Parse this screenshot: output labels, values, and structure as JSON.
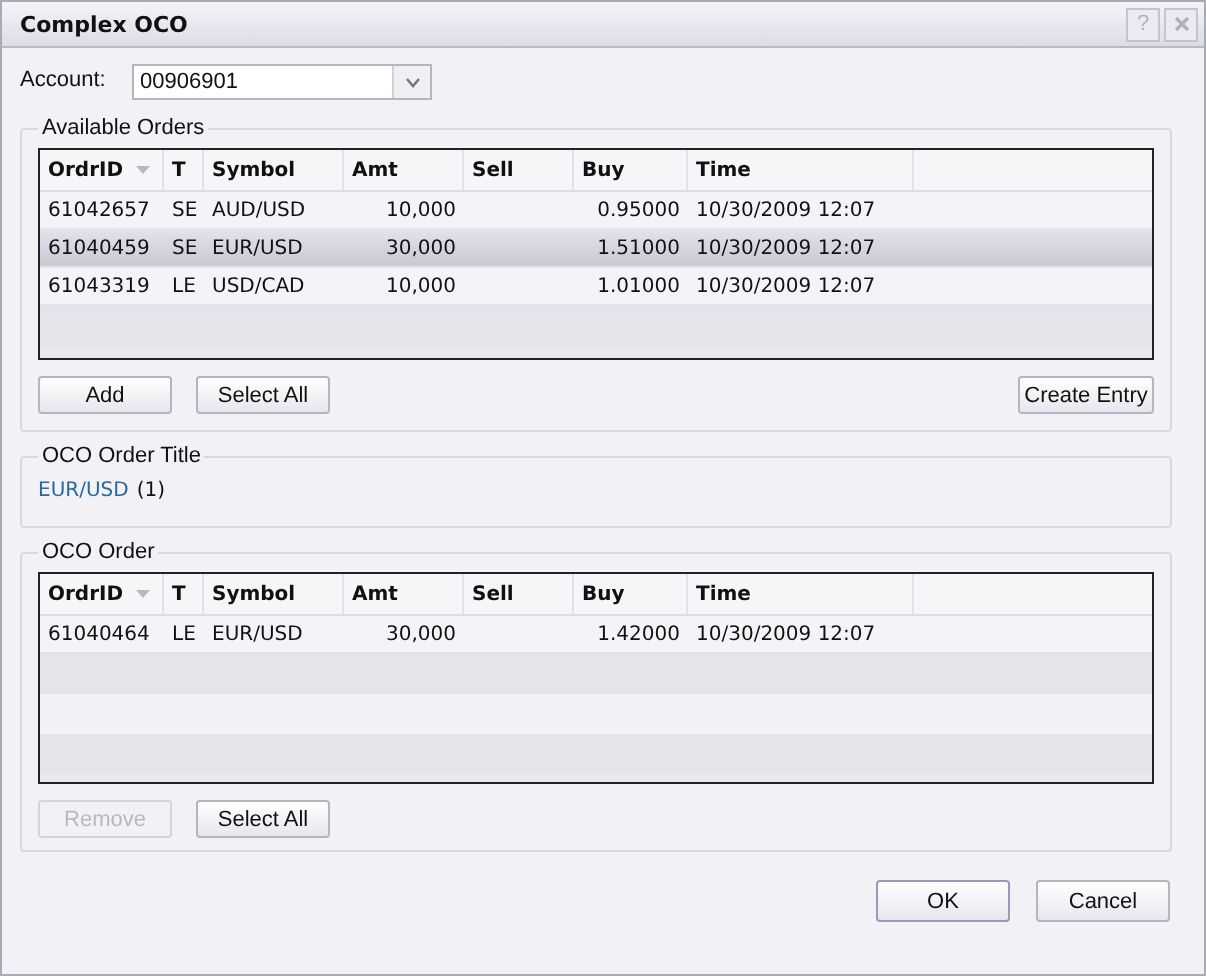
{
  "window": {
    "title": "Complex OCO",
    "help_label": "?"
  },
  "account": {
    "label": "Account:",
    "value": "00906901"
  },
  "available_orders": {
    "title": "Available Orders",
    "columns": [
      "OrdrID",
      "T",
      "Symbol",
      "Amt",
      "Sell",
      "Buy",
      "Time"
    ],
    "rows": [
      {
        "cells": [
          "61042657",
          "SE",
          "AUD/USD",
          "10,000",
          "",
          "0.95000",
          "10/30/2009 12:07"
        ],
        "selected": false
      },
      {
        "cells": [
          "61040459",
          "SE",
          "EUR/USD",
          "30,000",
          "",
          "1.51000",
          "10/30/2009 12:07"
        ],
        "selected": true
      },
      {
        "cells": [
          "61043319",
          "LE",
          "USD/CAD",
          "10,000",
          "",
          "1.01000",
          "10/30/2009 12:07"
        ],
        "selected": false
      }
    ],
    "buttons": [
      {
        "label": "Add",
        "disabled": false
      },
      {
        "label": "Select All",
        "disabled": false
      }
    ],
    "right_button": {
      "label": "Create Entry",
      "disabled": false
    }
  },
  "oco_order_title": {
    "title": "OCO Order Title",
    "symbol": "EUR/USD",
    "count": "(1)"
  },
  "oco_order": {
    "title": "OCO Order",
    "columns": [
      "OrdrID",
      "T",
      "Symbol",
      "Amt",
      "Sell",
      "Buy",
      "Time"
    ],
    "rows": [
      {
        "cells": [
          "61040464",
          "LE",
          "EUR/USD",
          "30,000",
          "",
          "1.42000",
          "10/30/2009 12:07"
        ],
        "selected": false
      }
    ],
    "buttons": [
      {
        "label": "Remove",
        "disabled": true
      },
      {
        "label": "Select All",
        "disabled": false
      }
    ]
  },
  "footer_buttons": [
    {
      "label": "OK",
      "default": true
    },
    {
      "label": "Cancel",
      "default": false
    }
  ]
}
